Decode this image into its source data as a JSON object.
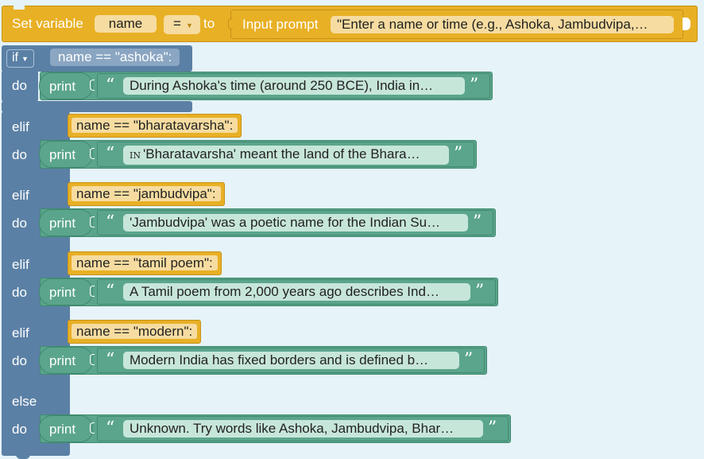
{
  "set_block": {
    "label": "Set variable",
    "variable": "name",
    "op": "=",
    "to_label": "to",
    "input_label": "Input prompt",
    "prompt_value": "\"Enter a name or time (e.g., Ashoka, Jambudvipa,…"
  },
  "if_block": {
    "if_label": "if",
    "elif_label": "elif",
    "else_label": "else",
    "do_label": "do",
    "print_label": "print",
    "open_quote": "“",
    "close_quote": "”",
    "branches": [
      {
        "condition": "name == \"ashoka\":",
        "text": "During Ashoka's time (around 250 BCE), India in…"
      },
      {
        "condition": "name == \"bharatavarsha\":",
        "text_prefix": "IN",
        "text": "'Bharatavarsha' meant the land of the Bhara…"
      },
      {
        "condition": "name == \"jambudvipa\":",
        "text": "'Jambudvipa' was a poetic name for the Indian Su…"
      },
      {
        "condition": "name == \"tamil poem\":",
        "text": "A Tamil poem from 2,000 years ago describes Ind…"
      },
      {
        "condition": "name == \"modern\":",
        "text": "Modern India has fixed borders and is defined b…"
      }
    ],
    "else_text": "Unknown. Try words like Ashoka, Jambudvipa, Bhar…"
  }
}
